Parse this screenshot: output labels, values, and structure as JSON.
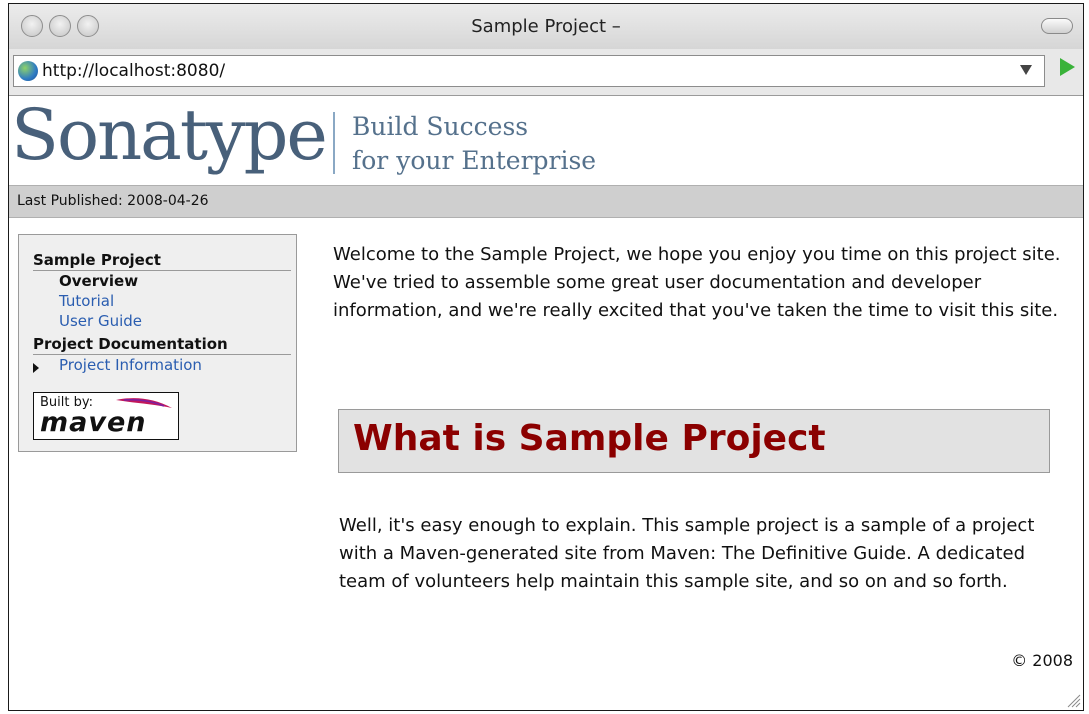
{
  "window": {
    "title": "Sample Project –"
  },
  "toolbar": {
    "url": "http://localhost:8080/"
  },
  "banner": {
    "logo": "Sonatype",
    "tagline_line1": "Build Success",
    "tagline_line2": "for your Enterprise"
  },
  "pubbar": {
    "text": "Last Published: 2008-04-26"
  },
  "sidebar": {
    "section1": "Sample Project",
    "items1": [
      "Overview",
      "Tutorial",
      "User Guide"
    ],
    "section2": "Project Documentation",
    "items2": [
      "Project Information"
    ],
    "builtby_label": "Built by:",
    "builtby_brand": "maven"
  },
  "main": {
    "intro": "Welcome to the Sample Project, we hope you enjoy you time on this project site. We've tried to assemble some great user documentation and developer information, and we're really excited that you've taken the time to visit this site.",
    "heading": "What is Sample Project",
    "body": "Well, it's easy enough to explain. This sample project is a sample of a project with a Maven-generated site from Maven: The Definitive Guide. A dedicated team of volunteers help maintain this sample site, and so on and so forth.",
    "copyright": "© 2008"
  },
  "colors": {
    "link": "#2a5db0",
    "heading": "#8b0000",
    "logo": "#48607a"
  }
}
